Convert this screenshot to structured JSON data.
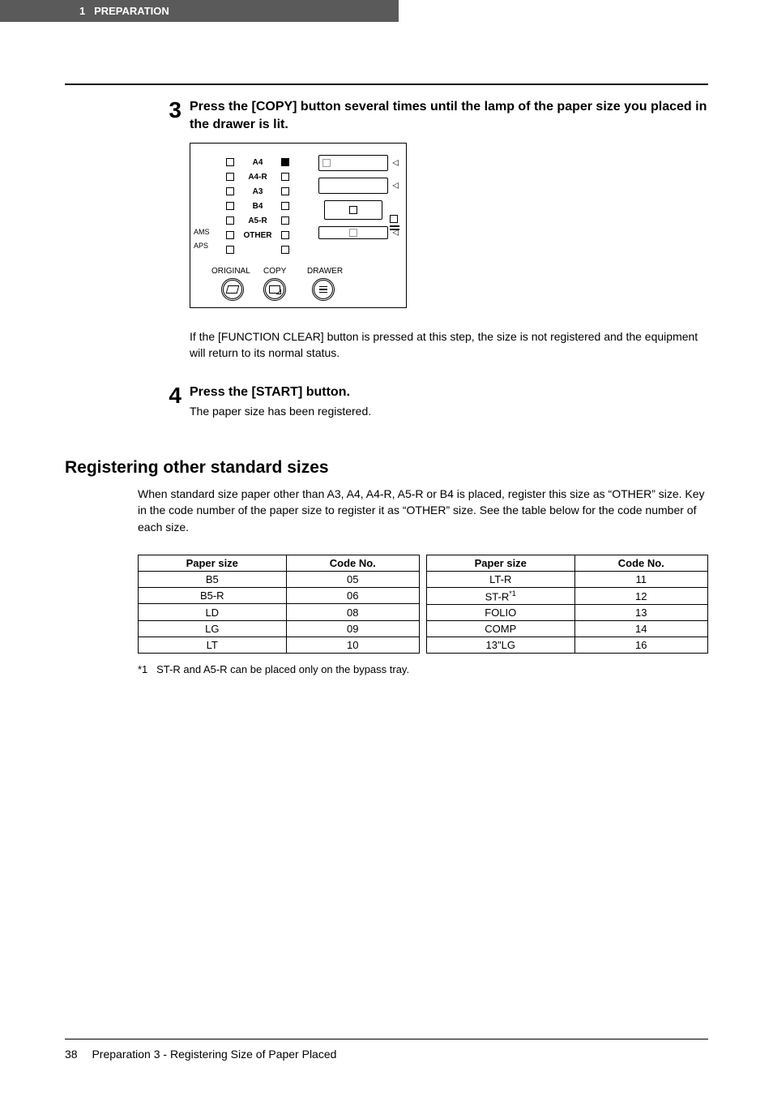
{
  "header": {
    "chapter_num": "1",
    "chapter_title": "PREPARATION"
  },
  "step3": {
    "number": "3",
    "title": "Press the [COPY] button several times until the lamp of the paper size you placed in the drawer is lit.",
    "note": "If the [FUNCTION CLEAR] button is pressed at this step, the size is not registered and the equipment will return to its normal status."
  },
  "panel": {
    "sizes": [
      "A4",
      "A4-R",
      "A3",
      "B4",
      "A5-R",
      "OTHER"
    ],
    "ams": "AMS",
    "aps": "APS",
    "labels": {
      "original": "ORIGINAL",
      "copy": "COPY",
      "drawer": "DRAWER"
    }
  },
  "step4": {
    "number": "4",
    "title": "Press the [START] button.",
    "body": "The paper size has been registered."
  },
  "section": {
    "heading": "Registering other standard sizes",
    "intro": "When standard size paper other than A3, A4, A4-R, A5-R or B4 is placed, register this size as “OTHER” size. Key in the code number of the paper size to register it as “OTHER” size. See the table below for the code number of each size."
  },
  "table": {
    "headers": {
      "size": "Paper size",
      "code": "Code No."
    },
    "left": [
      {
        "size": "B5",
        "code": "05"
      },
      {
        "size": "B5-R",
        "code": "06"
      },
      {
        "size": "LD",
        "code": "08"
      },
      {
        "size": "LG",
        "code": "09"
      },
      {
        "size": "LT",
        "code": "10"
      }
    ],
    "right": [
      {
        "size": "LT-R",
        "code": "11"
      },
      {
        "size": "ST-R",
        "sup": "*1",
        "code": "12"
      },
      {
        "size": "FOLIO",
        "code": "13"
      },
      {
        "size": "COMP",
        "code": "14"
      },
      {
        "size": "13\"LG",
        "code": "16"
      }
    ]
  },
  "footnote": {
    "mark": "*1",
    "text": "ST-R and A5-R can be placed only on the bypass tray."
  },
  "footer": {
    "page": "38",
    "text": "Preparation 3 - Registering Size of Paper Placed"
  }
}
